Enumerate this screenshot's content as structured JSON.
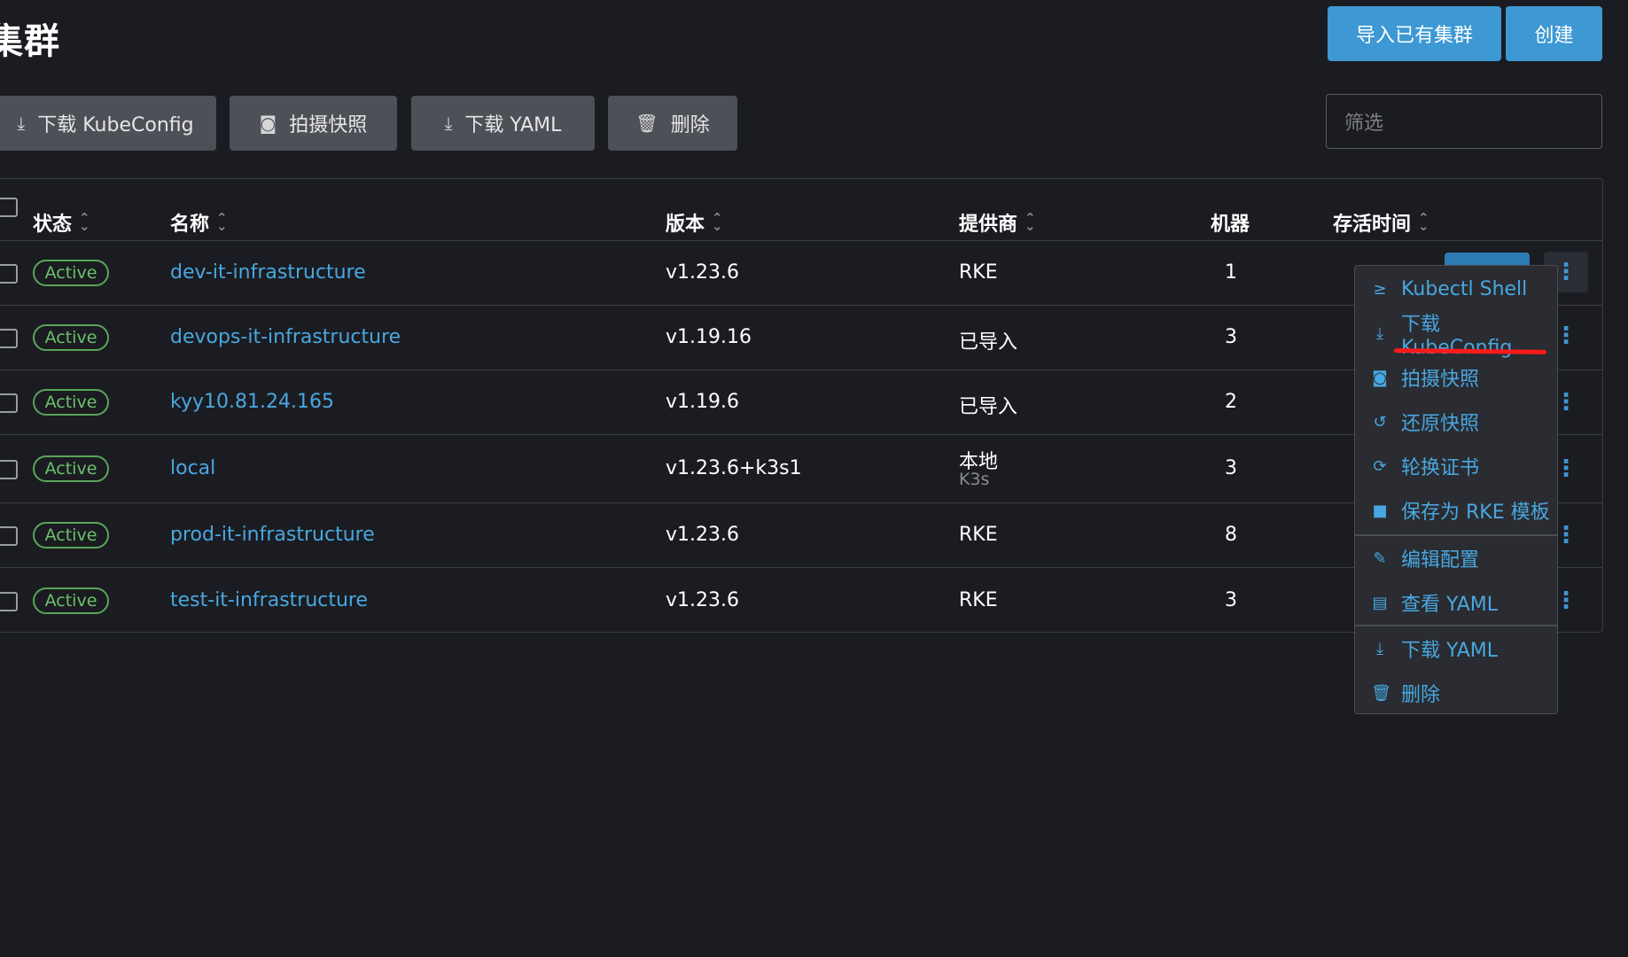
{
  "page": {
    "title": "集群"
  },
  "header_buttons": {
    "import_label": "导入已有集群",
    "create_label": "创建"
  },
  "bulk_actions": {
    "download_kubeconfig": "下载 KubeConfig",
    "take_snapshot": "拍摄快照",
    "download_yaml": "下载 YAML",
    "delete": "删除"
  },
  "filter": {
    "placeholder": "筛选"
  },
  "table": {
    "columns": {
      "state": "状态",
      "name": "名称",
      "version": "版本",
      "provider": "提供商",
      "machines": "机器",
      "age": "存活时间"
    },
    "rows": [
      {
        "state": "Active",
        "name": "dev-it-infrastructure",
        "version": "v1.23.6",
        "provider": "RKE",
        "provider_sub": "",
        "machines": "1"
      },
      {
        "state": "Active",
        "name": "devops-it-infrastructure",
        "version": "v1.19.16",
        "provider": "已导入",
        "provider_sub": "",
        "machines": "3"
      },
      {
        "state": "Active",
        "name": "kyy10.81.24.165",
        "version": "v1.19.6",
        "provider": "已导入",
        "provider_sub": "",
        "machines": "2"
      },
      {
        "state": "Active",
        "name": "local",
        "version": "v1.23.6+k3s1",
        "provider": "本地",
        "provider_sub": "K3s",
        "machines": "3"
      },
      {
        "state": "Active",
        "name": "prod-it-infrastructure",
        "version": "v1.23.6",
        "provider": "RKE",
        "provider_sub": "",
        "machines": "8"
      },
      {
        "state": "Active",
        "name": "test-it-infrastructure",
        "version": "v1.23.6",
        "provider": "RKE",
        "provider_sub": "",
        "machines": "3"
      }
    ]
  },
  "action_menu": {
    "items": [
      {
        "label": "Kubectl Shell",
        "icon": "terminal-icon"
      },
      {
        "label": "下载 KubeConfig",
        "icon": "download-icon"
      },
      {
        "label": "拍摄快照",
        "icon": "camera-icon"
      },
      {
        "label": "还原快照",
        "icon": "restore-icon"
      },
      {
        "label": "轮换证书",
        "icon": "rotate-icon"
      },
      {
        "label": "保存为 RKE 模板",
        "icon": "folder-icon"
      },
      {
        "label": "编辑配置",
        "icon": "pencil-icon"
      },
      {
        "label": "查看 YAML",
        "icon": "file-icon"
      },
      {
        "label": "下载 YAML",
        "icon": "download-icon"
      },
      {
        "label": "删除",
        "icon": "trash-icon"
      }
    ]
  },
  "colors": {
    "background": "#1b1c21",
    "primary": "#3d98d3",
    "link": "#48a7e0",
    "active": "#6cc06c",
    "annotation": "#ff1a1a"
  }
}
